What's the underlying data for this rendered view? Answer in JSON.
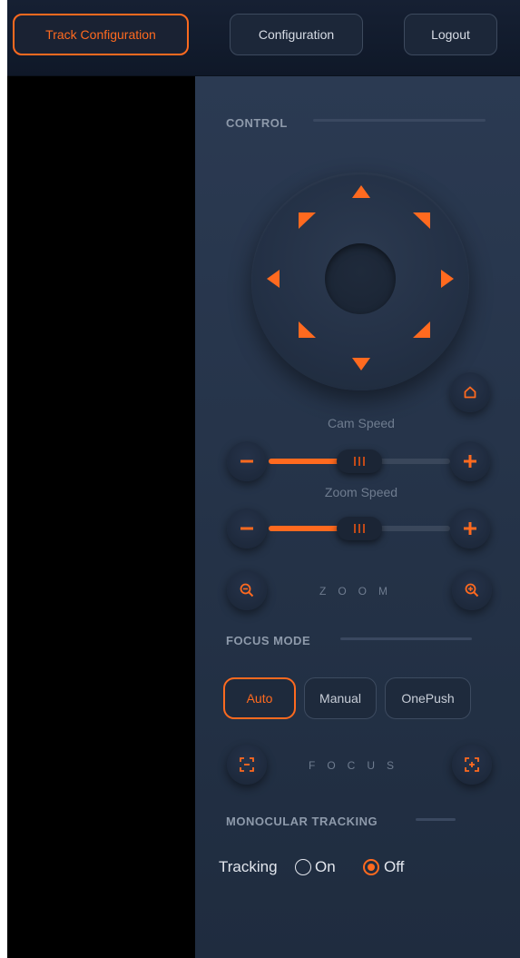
{
  "topbar": {
    "buttons": [
      {
        "label": "Track Configuration",
        "active": true
      },
      {
        "label": "Configuration",
        "active": false
      },
      {
        "label": "Logout",
        "active": false
      }
    ]
  },
  "control": {
    "title": "CONTROL",
    "cam_speed": {
      "label": "Cam Speed",
      "value_percent": 43
    },
    "zoom_speed": {
      "label": "Zoom Speed",
      "value_percent": 43
    },
    "zoom_label": "ZOOM"
  },
  "focus_mode": {
    "title": "FOCUS MODE",
    "options": [
      "Auto",
      "Manual",
      "OnePush"
    ],
    "selected": "Auto",
    "focus_label": "FOCUS"
  },
  "tracking": {
    "title": "MONOCULAR TRACKING",
    "label": "Tracking",
    "on_label": "On",
    "off_label": "Off",
    "selected": "Off"
  },
  "colors": {
    "accent": "#ff6a1f",
    "panel": "#243247",
    "topbar": "#121b2b"
  },
  "icons": {
    "home": "home-icon",
    "minus": "minus-icon",
    "plus": "plus-icon",
    "zoom_out": "zoom-out-icon",
    "zoom_in": "zoom-in-icon",
    "focus_near": "focus-near-icon",
    "focus_far": "focus-far-icon"
  }
}
